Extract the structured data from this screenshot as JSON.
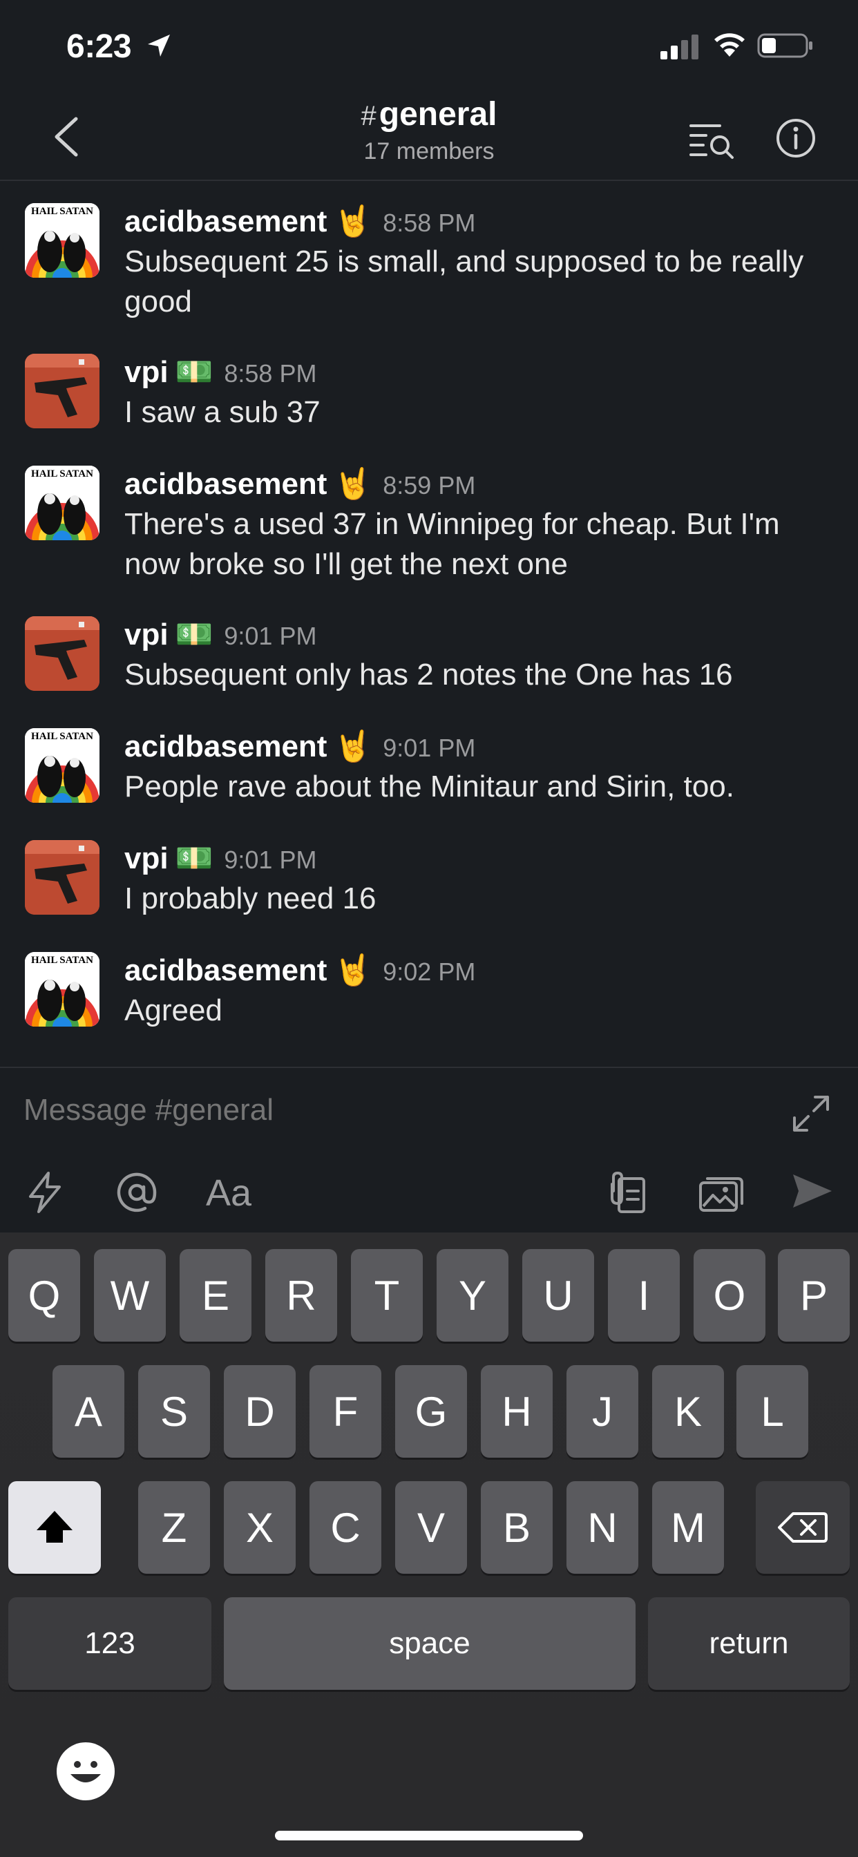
{
  "status_bar": {
    "time": "6:23",
    "icons": [
      "location-arrow-icon",
      "signal-icon",
      "wifi-icon",
      "battery-icon"
    ]
  },
  "header": {
    "hash": "#",
    "channel_name": "general",
    "member_count": "17 members"
  },
  "messages": [
    {
      "author": "acidbasement",
      "status_emoji": "🤘",
      "time": "8:58 PM",
      "avatar": "satan",
      "text": "Subsequent 25 is small, and supposed to be really good"
    },
    {
      "author": "vpi",
      "status_emoji": "💵",
      "time": "8:58 PM",
      "avatar": "gun",
      "text": "I saw a sub 37"
    },
    {
      "author": "acidbasement",
      "status_emoji": "🤘",
      "time": "8:59 PM",
      "avatar": "satan",
      "text": "There's a used 37 in Winnipeg for cheap. But I'm now broke so I'll get the next one"
    },
    {
      "author": "vpi",
      "status_emoji": "💵",
      "time": "9:01 PM",
      "avatar": "gun",
      "text": "Subsequent only has 2 notes the One has 16"
    },
    {
      "author": "acidbasement",
      "status_emoji": "🤘",
      "time": "9:01 PM",
      "avatar": "satan",
      "text": "People rave about the Minitaur and Sirin, too."
    },
    {
      "author": "vpi",
      "status_emoji": "💵",
      "time": "9:01 PM",
      "avatar": "gun",
      "text": "I probably need 16"
    },
    {
      "author": "acidbasement",
      "status_emoji": "🤘",
      "time": "9:02 PM",
      "avatar": "satan",
      "text": "Agreed"
    }
  ],
  "avatar_text": "HAIL SATAN",
  "composer": {
    "placeholder": "Message #general",
    "format_label": "Aa"
  },
  "keyboard": {
    "row1": [
      "Q",
      "W",
      "E",
      "R",
      "T",
      "Y",
      "U",
      "I",
      "O",
      "P"
    ],
    "row2": [
      "A",
      "S",
      "D",
      "F",
      "G",
      "H",
      "J",
      "K",
      "L"
    ],
    "row3": [
      "Z",
      "X",
      "C",
      "V",
      "B",
      "N",
      "M"
    ],
    "numbers_label": "123",
    "space_label": "space",
    "return_label": "return"
  },
  "colors": {
    "background": "#1a1d21",
    "text_primary": "#ffffff",
    "text_secondary": "#9a9b9d",
    "keyboard_bg": "#2c2c2e",
    "key_bg": "#5a5a5e"
  }
}
